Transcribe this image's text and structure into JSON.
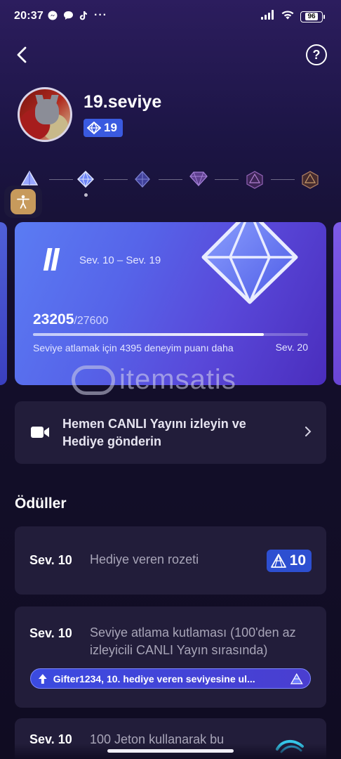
{
  "status_bar": {
    "time": "20:37",
    "more": "···",
    "battery": "96"
  },
  "header": {
    "help": "?"
  },
  "profile": {
    "title": "19.seviye",
    "badge_level": "19"
  },
  "level_card": {
    "roman": "II",
    "range": "Sev. 10 – Sev. 19",
    "current_points": "23205",
    "total_points": "/27600",
    "progress": 0.84,
    "hint": "Seviye atlamak için 4395 deneyim puanı daha",
    "next_level": "Sev. 20"
  },
  "watermark": {
    "text": "itemsatis"
  },
  "live_cta": {
    "label": "Hemen CANLI Yayını izleyin ve Hediye gönderin"
  },
  "rewards": {
    "title": "Ödüller",
    "items": [
      {
        "level": "Sev. 10",
        "desc": "Hediye veren rozeti",
        "badge": "10"
      },
      {
        "level": "Sev. 10",
        "desc": "Seviye atlama kutlaması (100'den az izleyicili CANLI Yayın sırasında)",
        "notification": "Gifter1234, 10. hediye veren seviyesine ul..."
      },
      {
        "level": "Sev. 10",
        "desc": "100 Jeton kullanarak bu"
      }
    ]
  },
  "colors": {
    "accent": "#3a5ae0",
    "card_start": "#5b7cf3",
    "card_end": "#4a2dbd",
    "row_bg": "#221d3a"
  }
}
